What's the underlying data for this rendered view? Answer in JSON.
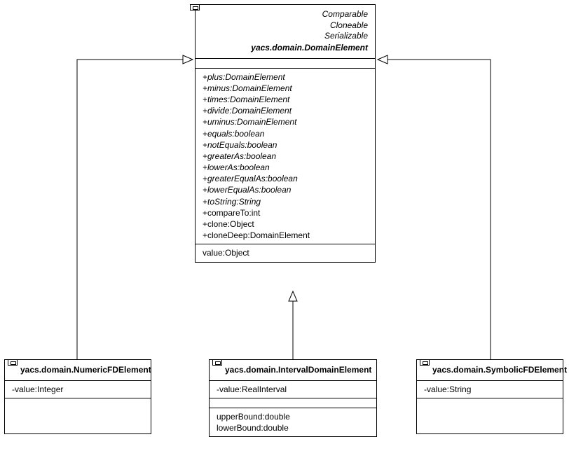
{
  "parent": {
    "stereotypes": [
      "Comparable",
      "Cloneable",
      "Serializable"
    ],
    "name": "yacs.domain.DomainElement",
    "methods": [
      "+plus:DomainElement",
      "+minus:DomainElement",
      "+times:DomainElement",
      "+divide:DomainElement",
      "+uminus:DomainElement",
      "+equals:boolean",
      "+notEquals:boolean",
      "+greaterAs:boolean",
      "+lowerAs:boolean",
      "+greaterEqualAs:boolean",
      "+lowerEqualAs:boolean",
      "+toString:String",
      "+compareTo:int",
      "+clone:Object",
      "+cloneDeep:DomainElement"
    ],
    "properties": [
      "value:Object"
    ]
  },
  "children": {
    "numeric": {
      "name": "yacs.domain.NumericFDElement",
      "attrs": [
        "-value:Integer"
      ]
    },
    "interval": {
      "name": "yacs.domain.IntervalDomainElement",
      "attrs": [
        "-value:RealInterval"
      ],
      "extra": [
        "upperBound:double",
        "lowerBound:double"
      ]
    },
    "symbolic": {
      "name": "yacs.domain.SymbolicFDElement",
      "attrs": [
        "-value:String"
      ]
    }
  }
}
